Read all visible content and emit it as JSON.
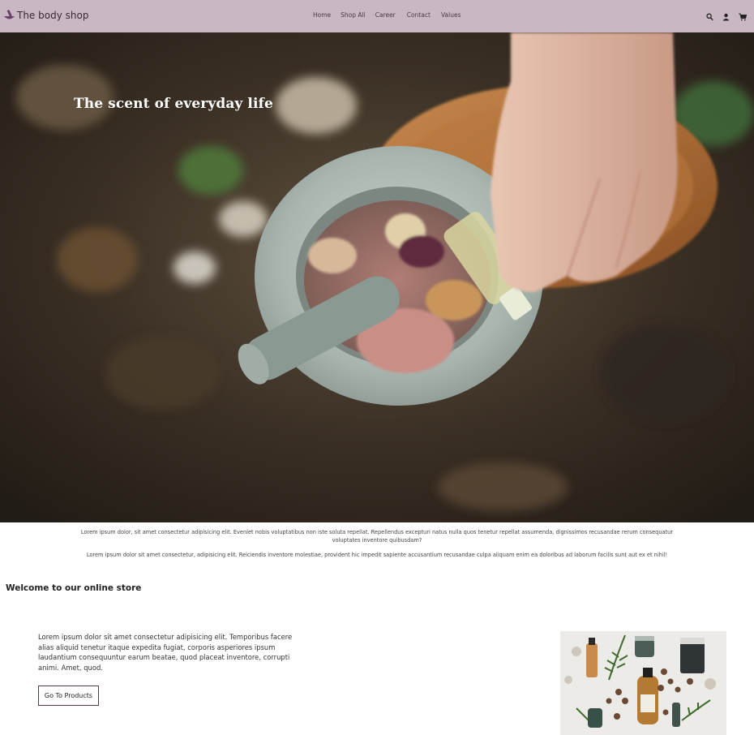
{
  "brand": {
    "name": "The body shop",
    "logo_icon": "pestle-bowl-icon",
    "logo_color": "#6b3f6a"
  },
  "nav": {
    "links": [
      "Home",
      "Shop All",
      "Career",
      "Contact",
      "Values"
    ],
    "icons": [
      "search-icon",
      "user-icon",
      "cart-icon"
    ],
    "background": "#c9b7c3"
  },
  "hero": {
    "title": "The scent of everyday life"
  },
  "intro": {
    "paragraph1": "Lorem ipsum dolor, sit amet consectetur adipisicing elit. Eveniet nobis voluptatibus non iste soluta repellat. Repellendus excepturi natus nulla quos tenetur repellat assumenda, dignissimos recusandae rerum consequatur voluptates inventore quibusdam?",
    "paragraph2": "Lorem ipsum dolor sit amet consectetur, adipisicing elit. Reiciendis inventore molestiae, provident hic impedit sapiente accusantium recusandae culpa aliquam enim ea doloribus ad laborum facilis sunt aut ex et nihil!"
  },
  "welcome": {
    "heading": "Welcome to our online store",
    "description": "Lorem ipsum dolor sit amet consectetur adipisicing elit. Temporibus facere alias aliquid tenetur itaque expedita fugiat, corporis asperiores ipsum laudantium consequuntur earum beatae, quod placeat inventore, corrupti animi. Amet, quod.",
    "button_label": "Go To Products"
  }
}
